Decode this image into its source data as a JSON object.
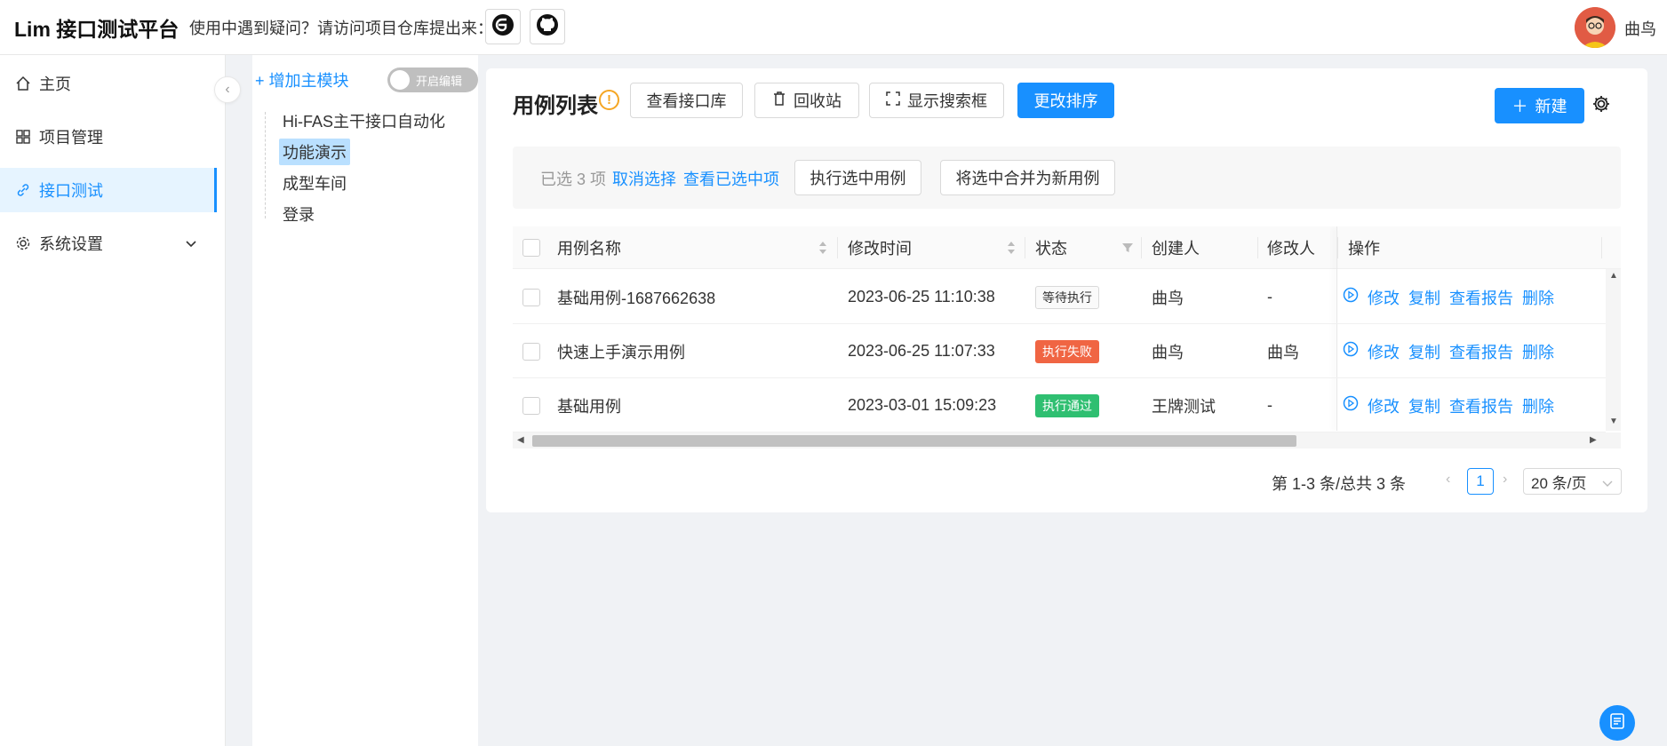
{
  "header": {
    "app_title": "Lim 接口测试平台",
    "hint": "使用中遇到疑问？请访问项目仓库提出来：",
    "user_name": "曲鸟"
  },
  "sidebar": {
    "items": [
      {
        "label": "主页",
        "icon": "home-icon"
      },
      {
        "label": "项目管理",
        "icon": "grid-icon"
      },
      {
        "label": "接口测试",
        "icon": "link-icon"
      },
      {
        "label": "系统设置",
        "icon": "gear-icon"
      }
    ]
  },
  "tree": {
    "add_label": "+ 增加主模块",
    "toggle_label": "开启编辑",
    "nodes": [
      "Hi-FAS主干接口自动化",
      "功能演示",
      "成型车间",
      "登录"
    ]
  },
  "main": {
    "title": "用例列表",
    "buttons": {
      "api_lib": "查看接口库",
      "recycle": "回收站",
      "show_search": "显示搜索框",
      "sort": "更改排序",
      "new": "新建"
    },
    "selection": {
      "count": "已选 3 项",
      "cancel": "取消选择",
      "view": "查看已选中项",
      "run": "执行选中用例",
      "merge": "将选中合并为新用例"
    },
    "table": {
      "columns": [
        "用例名称",
        "修改时间",
        "状态",
        "创建人",
        "修改人",
        "操作"
      ],
      "rows": [
        {
          "name": "基础用例-1687662638",
          "time": "2023-06-25 11:10:38",
          "status": "等待执行",
          "creator": "曲鸟",
          "modifier": "-"
        },
        {
          "name": "快速上手演示用例",
          "time": "2023-06-25 11:07:33",
          "status": "执行失败",
          "creator": "曲鸟",
          "modifier": "曲鸟"
        },
        {
          "name": "基础用例",
          "time": "2023-03-01 15:09:23",
          "status": "执行通过",
          "creator": "王牌测试",
          "modifier": "-"
        }
      ],
      "actions": [
        "修改",
        "复制",
        "查看报告",
        "删除"
      ]
    },
    "pagination": {
      "total": "第 1-3 条/总共 3 条",
      "current": "1",
      "page_size": "20 条/页"
    }
  },
  "colors": {
    "accent": "#1890ff",
    "status_waiting": "#fafafa",
    "status_fail": "#f06543",
    "status_pass": "#2fbf71"
  }
}
